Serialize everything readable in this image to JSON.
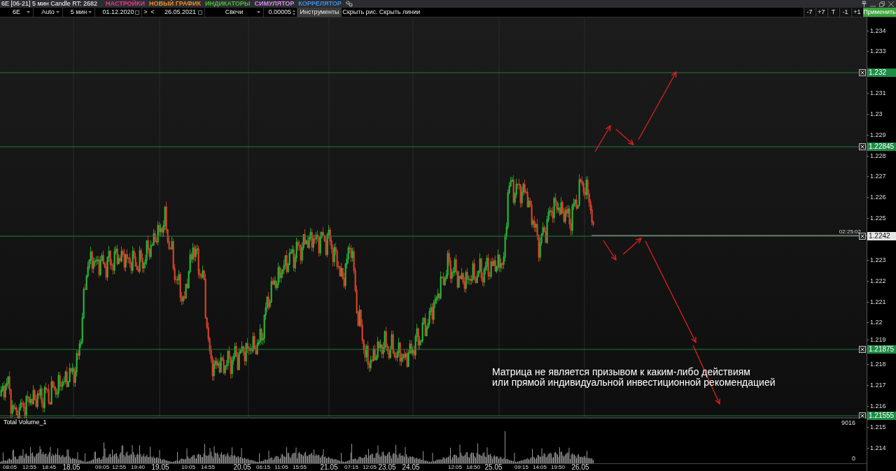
{
  "title_bar": {
    "title": "6E [06-21] 5 мин Candle RT: 2682",
    "menu": [
      {
        "label": "НАСТРОЙКИ",
        "color": "#e8378f"
      },
      {
        "label": "НОВЫЙ ГРАФИК",
        "color": "#f08a24"
      },
      {
        "label": "ИНДИКАТОРЫ",
        "color": "#4cbb3c"
      },
      {
        "label": "СИМУЛЯТОР",
        "color": "#d68ce8"
      },
      {
        "label": "КОРРЕЛЯТОР",
        "color": "#3f8fe8"
      }
    ]
  },
  "toolbar": [
    {
      "kind": "dropdown",
      "value": "6E"
    },
    {
      "kind": "dropdown",
      "value": "Auto"
    },
    {
      "kind": "dropdown",
      "value": "5 мин"
    },
    {
      "kind": "date",
      "value": "01.12.2020"
    },
    {
      "kind": "button",
      "label": ">",
      "pressed": false
    },
    {
      "kind": "button",
      "label": "<",
      "pressed": false
    },
    {
      "kind": "date",
      "value": "26.05.2021"
    },
    {
      "kind": "dropdown",
      "value": "Свечи"
    },
    {
      "kind": "spinner",
      "value": "0.00005"
    },
    {
      "kind": "button",
      "label": "Инструменты",
      "pressed": true
    },
    {
      "kind": "button",
      "label": "Скрыть рис.",
      "pressed": false
    },
    {
      "kind": "button",
      "label": "Скрыть линии",
      "pressed": false
    }
  ],
  "toolbar_right": [
    {
      "label": "-7",
      "primary": false
    },
    {
      "label": "+7",
      "primary": false
    },
    {
      "label": "T",
      "primary": false
    },
    {
      "label": "-1",
      "primary": false
    },
    {
      "label": "+1",
      "primary": false
    },
    {
      "label": "Применить",
      "primary": true
    }
  ],
  "price_axis": [
    "1.234",
    "1.233",
    "1.231",
    "1.23",
    "1.229",
    "1.228",
    "1.227",
    "1.226",
    "1.225",
    "1.223",
    "1.222",
    "1.221",
    "1.22",
    "1.219",
    "1.218",
    "1.217",
    "1.216",
    "1.215",
    "1.214"
  ],
  "levels": [
    {
      "kind": "level",
      "price": "1.232"
    },
    {
      "kind": "level",
      "price": "1.22845"
    },
    {
      "kind": "current",
      "price": "1.2242",
      "time": "02:25:02"
    },
    {
      "kind": "level",
      "price": "1.21875"
    },
    {
      "kind": "level",
      "price": "1.21555"
    }
  ],
  "disclaimer": [
    "Матрица не является призывом к каким-либо действиям",
    "или прямой индивидуальной инвестиционной рекомендацией"
  ],
  "volume_pane": {
    "title": "Total Volume_1",
    "max": "9016",
    "min": "0"
  },
  "time_axis": [
    {
      "kind": "time",
      "label": "08:05"
    },
    {
      "kind": "time",
      "label": "12:55"
    },
    {
      "kind": "time",
      "label": "18:45"
    },
    {
      "kind": "date",
      "label": "18.05"
    },
    {
      "kind": "time",
      "label": "09:05"
    },
    {
      "kind": "time",
      "label": "12:55"
    },
    {
      "kind": "time",
      "label": "19:40"
    },
    {
      "kind": "date",
      "label": "19.05"
    },
    {
      "kind": "time",
      "label": "10:05"
    },
    {
      "kind": "time",
      "label": "14:55"
    },
    {
      "kind": "date",
      "label": "20.05"
    },
    {
      "kind": "time",
      "label": "06:15"
    },
    {
      "kind": "time",
      "label": "11:05"
    },
    {
      "kind": "time",
      "label": "15:55"
    },
    {
      "kind": "date",
      "label": "21.05"
    },
    {
      "kind": "time",
      "label": "07:15"
    },
    {
      "kind": "time",
      "label": "12:05"
    },
    {
      "kind": "date",
      "label": "23.05"
    },
    {
      "kind": "date",
      "label": "24.05"
    },
    {
      "kind": "time",
      "label": "12:05"
    },
    {
      "kind": "time",
      "label": "18:50"
    },
    {
      "kind": "date",
      "label": "25.05"
    },
    {
      "kind": "time",
      "label": "09:15"
    },
    {
      "kind": "time",
      "label": "14:05"
    },
    {
      "kind": "time",
      "label": "19:50"
    },
    {
      "kind": "date",
      "label": "26.05"
    }
  ]
}
